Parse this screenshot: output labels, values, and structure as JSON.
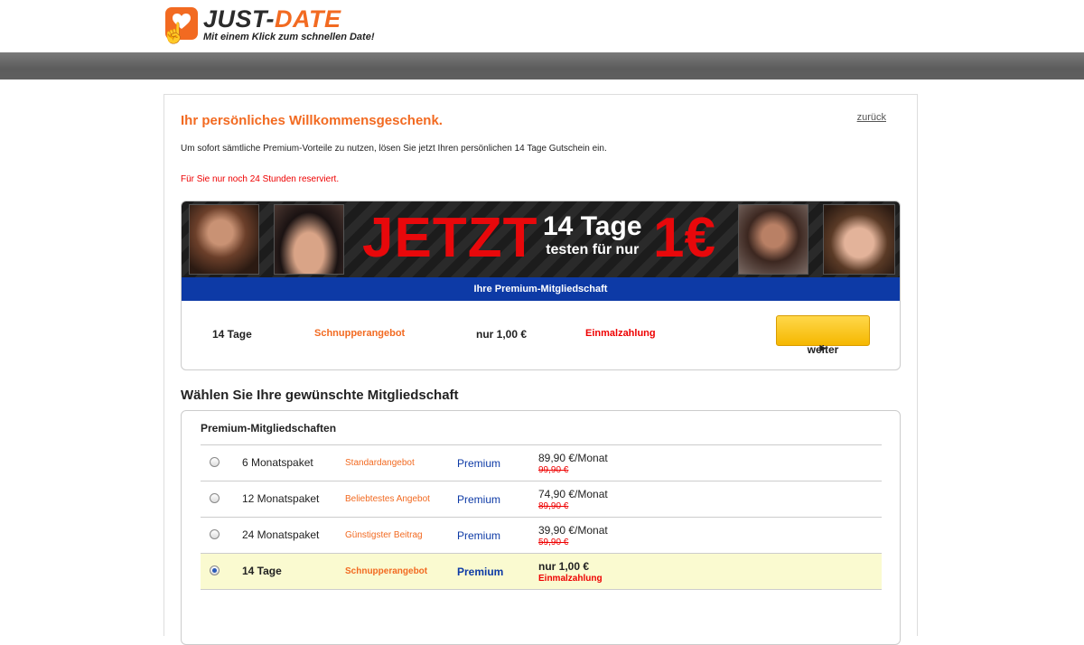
{
  "brand": {
    "name_part1": "JUST-",
    "name_part2": "DATE",
    "tagline": "Mit einem Klick zum schnellen Date!"
  },
  "page": {
    "title": "Ihr persönliches Willkommensgeschenk.",
    "back_link": "zurück",
    "intro": "Um sofort sämtliche Premium-Vorteile zu nutzen, lösen Sie jetzt Ihren persönlichen 14 Tage Gutschein ein.",
    "reserved": "Für Sie nur noch 24 Stunden reserviert."
  },
  "banner": {
    "jetzt": "JETZT",
    "tage": "14 Tage",
    "testen": "testen für nur",
    "price": "1€",
    "blue_bar": "Ihre Premium-Mitgliedschaft"
  },
  "offer": {
    "duration": "14 Tage",
    "type": "Schnupperangebot",
    "price": "nur 1,00 €",
    "payment": "Einmalzahlung",
    "button": "weiter"
  },
  "plans": {
    "section_title": "Wählen Sie Ihre gewünschte Mitgliedschaft",
    "box_title": "Premium-Mitgliedschaften",
    "items": [
      {
        "name": "6 Monatspaket",
        "tag": "Standardangebot",
        "level": "Premium",
        "price": "89,90 €/Monat",
        "old": "99,90 €",
        "selected": false
      },
      {
        "name": "12 Monatspaket",
        "tag": "Beliebtestes Angebot",
        "level": "Premium",
        "price": "74,90 €/Monat",
        "old": "89,90 €",
        "selected": false
      },
      {
        "name": "24 Monatspaket",
        "tag": "Günstigster Beitrag",
        "level": "Premium",
        "price": "39,90 €/Monat",
        "old": "59,90 €",
        "selected": false
      },
      {
        "name": "14 Tage",
        "tag": "Schnupperangebot",
        "level": "Premium",
        "price": "nur 1,00 €",
        "old": "Einmalzahlung",
        "selected": true
      }
    ]
  },
  "colors": {
    "accent_orange": "#f26a21",
    "banner_red": "#e8080b",
    "premium_blue": "#0d3aa6",
    "button_yellow": "#ffd84a"
  }
}
